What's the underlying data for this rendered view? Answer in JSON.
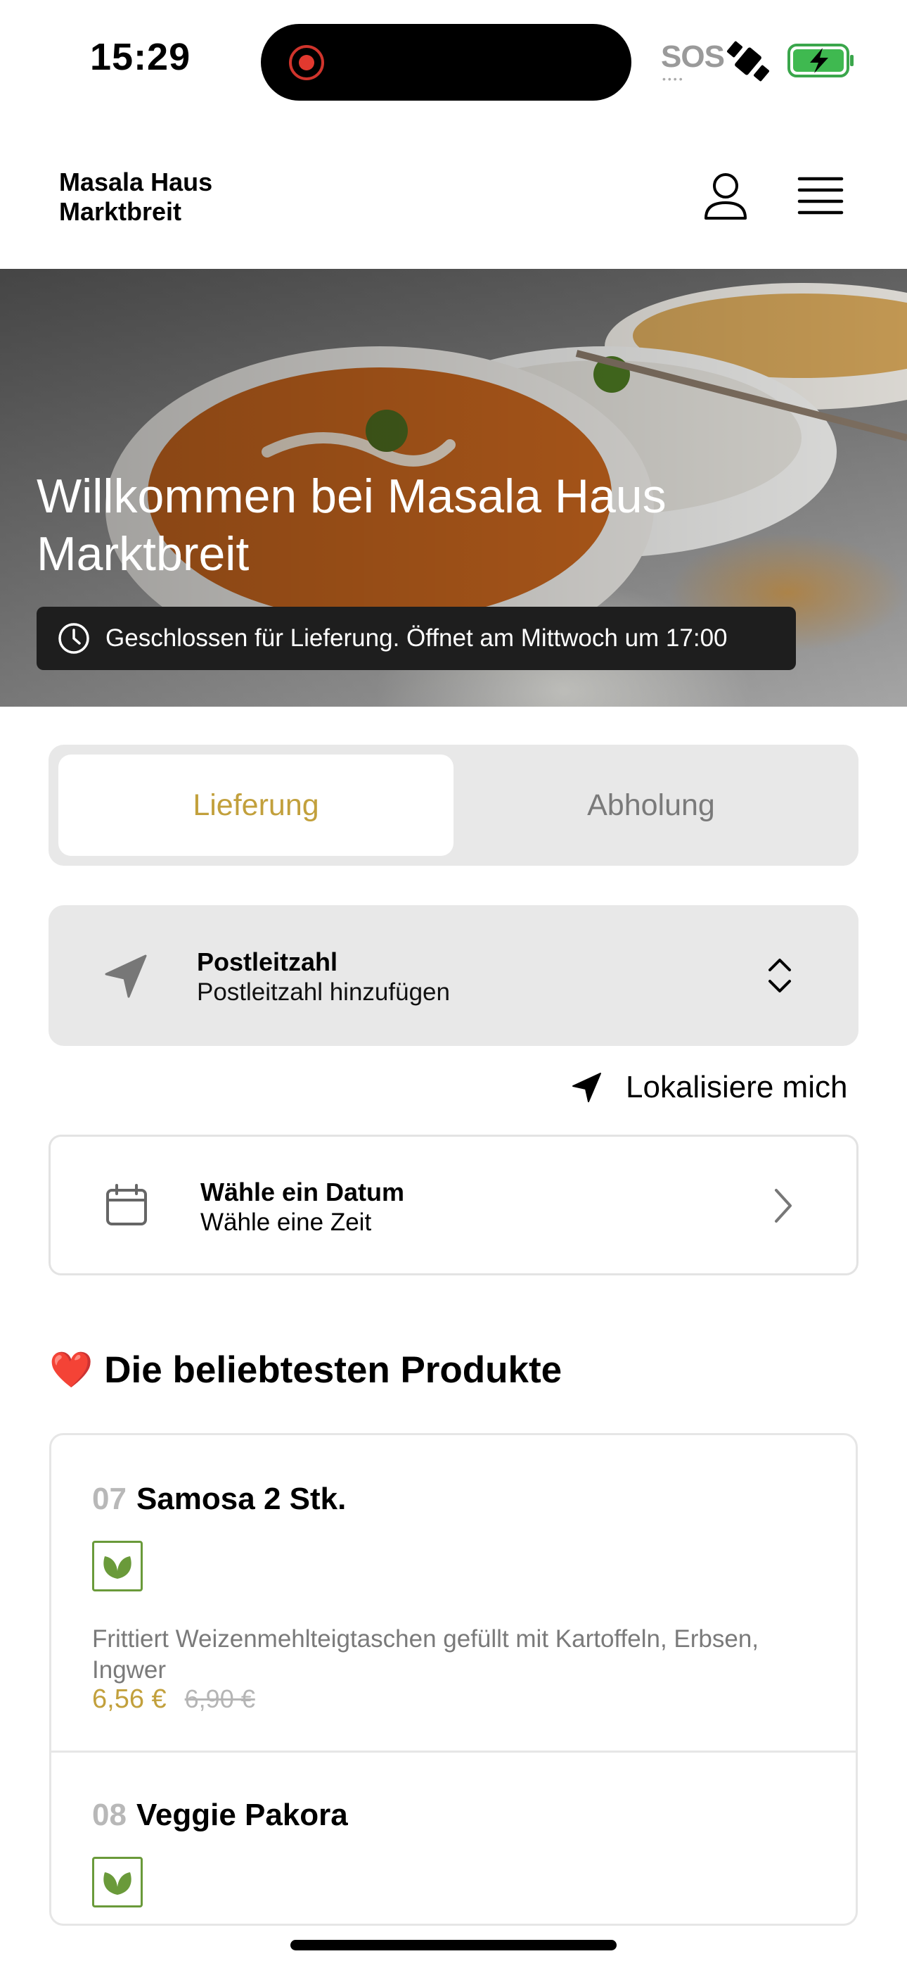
{
  "status_bar": {
    "time": "15:29",
    "sos": "SOS",
    "sos_dots": "••••"
  },
  "header": {
    "brand_line1": "Masala Haus",
    "brand_line2": "Marktbreit"
  },
  "hero": {
    "title_line1": "Willkommen bei Masala Haus",
    "title_line2": "Marktbreit",
    "hours_notice": "Geschlossen für Lieferung. Öffnet am Mittwoch um 17:00"
  },
  "tabs": {
    "delivery": "Lieferung",
    "pickup": "Abholung"
  },
  "postal": {
    "title": "Postleitzahl",
    "placeholder": "Postleitzahl hinzufügen"
  },
  "locate": {
    "label": "Lokalisiere mich"
  },
  "schedule": {
    "title": "Wähle ein Datum",
    "subtitle": "Wähle eine Zeit"
  },
  "popular": {
    "emoji": "❤️",
    "title": "Die beliebtesten Produkte"
  },
  "products": [
    {
      "number": "07",
      "name": "Samosa 2 Stk.",
      "description_line1": "Frittiert Weizenmehlteigtaschen gefüllt mit Kartoffeln, Erbsen,",
      "description_line2": "Ingwer",
      "price": "6,56 €",
      "old_price": "6,90 €"
    },
    {
      "number": "08",
      "name": "Veggie Pakora"
    }
  ],
  "colors": {
    "accent": "#c2a03c",
    "veg_green": "#6a9a3a",
    "panel_gray": "#e8e8e8"
  }
}
